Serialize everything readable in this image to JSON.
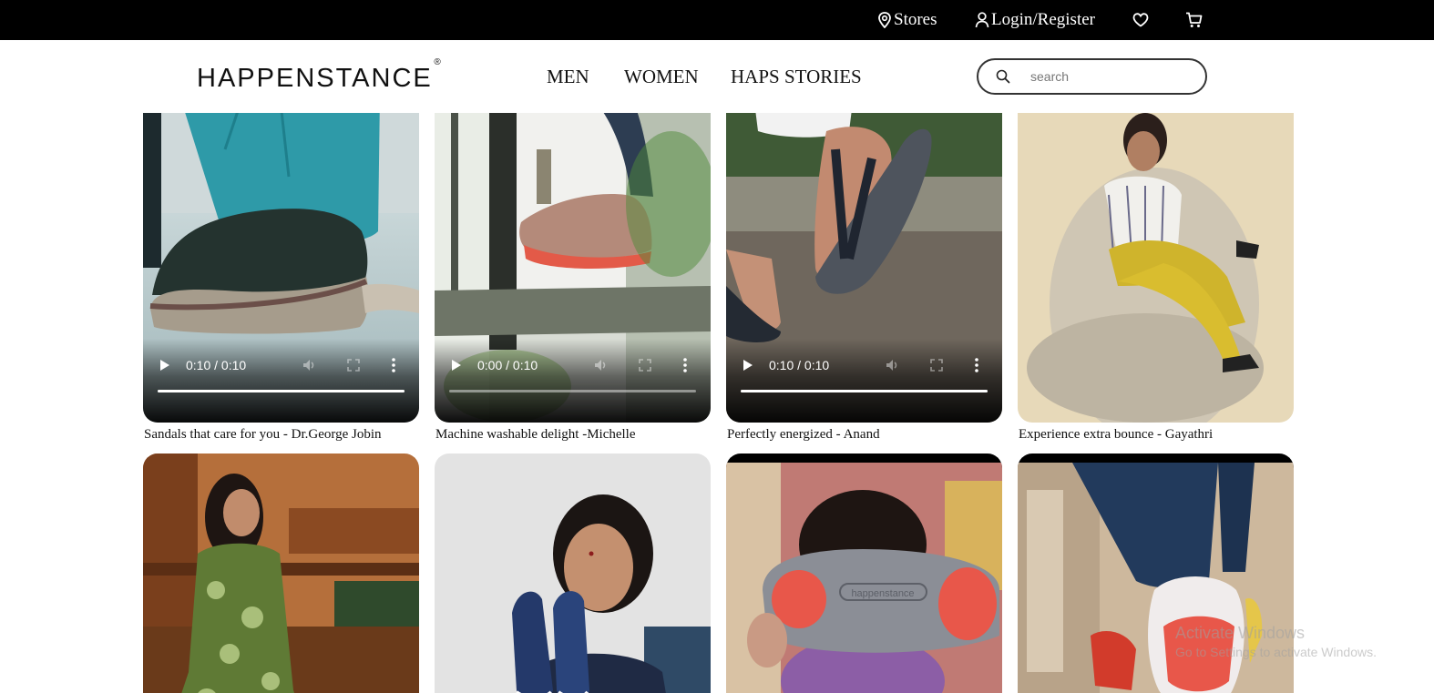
{
  "topbar": {
    "stores_label": "Stores",
    "login_label": "Login/Register",
    "wishlist_icon": "heart-icon",
    "cart_icon": "cart-icon"
  },
  "header": {
    "logo_text": "HAPPENSTANCE",
    "logo_mark": "®",
    "nav": [
      "MEN",
      "WOMEN",
      "HAPS STORIES"
    ],
    "search_placeholder": "search"
  },
  "stories": [
    {
      "caption": "Sandals that care for you - Dr.George Jobin",
      "type": "video",
      "time": "0:10 / 0:10",
      "progress": 1.0
    },
    {
      "caption": "Machine washable delight -Michelle",
      "type": "video",
      "time": "0:00 / 0:10",
      "progress": 0.0
    },
    {
      "caption": "Perfectly energized - Anand",
      "type": "video",
      "time": "0:10 / 0:10",
      "progress": 1.0
    },
    {
      "caption": "Experience extra bounce - Gayathri",
      "type": "image"
    },
    {
      "type": "image"
    },
    {
      "type": "image"
    },
    {
      "type": "video"
    },
    {
      "type": "video"
    }
  ],
  "watermark": {
    "line1": "Activate Windows",
    "line2": "Go to Settings to activate Windows."
  },
  "colors": {
    "topbar": "#000000",
    "accent_sole": "#e8574a"
  }
}
